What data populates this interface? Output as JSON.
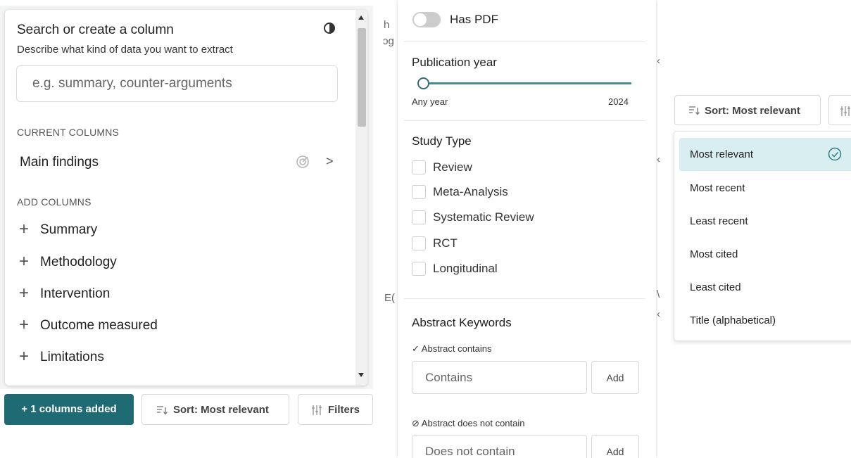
{
  "column_panel": {
    "title": "Search or create a column",
    "subtitle": "Describe what kind of data you want to extract",
    "search_placeholder": "e.g. summary, counter-arguments",
    "current_columns_heading": "CURRENT COLUMNS",
    "current_columns": [
      {
        "label": "Main findings",
        "icon": "target-icon"
      }
    ],
    "add_columns_heading": "ADD COLUMNS",
    "add_columns": [
      {
        "label": "Summary"
      },
      {
        "label": "Methodology"
      },
      {
        "label": "Intervention"
      },
      {
        "label": "Outcome measured"
      },
      {
        "label": "Limitations"
      }
    ]
  },
  "bottom_bar": {
    "columns_added_label": "+ 1 columns added",
    "sort_label": "Sort: Most relevant",
    "filters_label": "Filters"
  },
  "background_fragments": [
    "h",
    "ɔg",
    "‹",
    "E(",
    "‹",
    "\\",
    "‹"
  ],
  "filters_panel": {
    "has_pdf_label": "Has PDF",
    "has_pdf_on": false,
    "publication_year_heading": "Publication year",
    "year_min_label": "Any year",
    "year_max_label": "2024",
    "study_type_heading": "Study Type",
    "study_types": [
      {
        "label": "Review",
        "checked": false
      },
      {
        "label": "Meta-Analysis",
        "checked": false
      },
      {
        "label": "Systematic Review",
        "checked": false
      },
      {
        "label": "RCT",
        "checked": false
      },
      {
        "label": "Longitudinal",
        "checked": false
      }
    ],
    "abstract_keywords_heading": "Abstract Keywords",
    "contains_heading": "✓ Abstract contains",
    "contains_placeholder": "Contains",
    "contains_add": "Add",
    "not_contains_heading": "⊘ Abstract does not contain",
    "not_contains_placeholder": "Does not contain",
    "not_contains_add": "Add"
  },
  "sort_menu": {
    "button_label": "Sort: Most relevant",
    "options": [
      {
        "label": "Most relevant",
        "selected": true
      },
      {
        "label": "Most recent",
        "selected": false
      },
      {
        "label": "Least recent",
        "selected": false
      },
      {
        "label": "Most cited",
        "selected": false
      },
      {
        "label": "Least cited",
        "selected": false
      },
      {
        "label": "Title (alphabetical)",
        "selected": false
      }
    ]
  },
  "colors": {
    "accent": "#1e6b73",
    "slider": "#3f8e96",
    "selected_bg": "#d9eef0",
    "check": "#2f7d85"
  }
}
